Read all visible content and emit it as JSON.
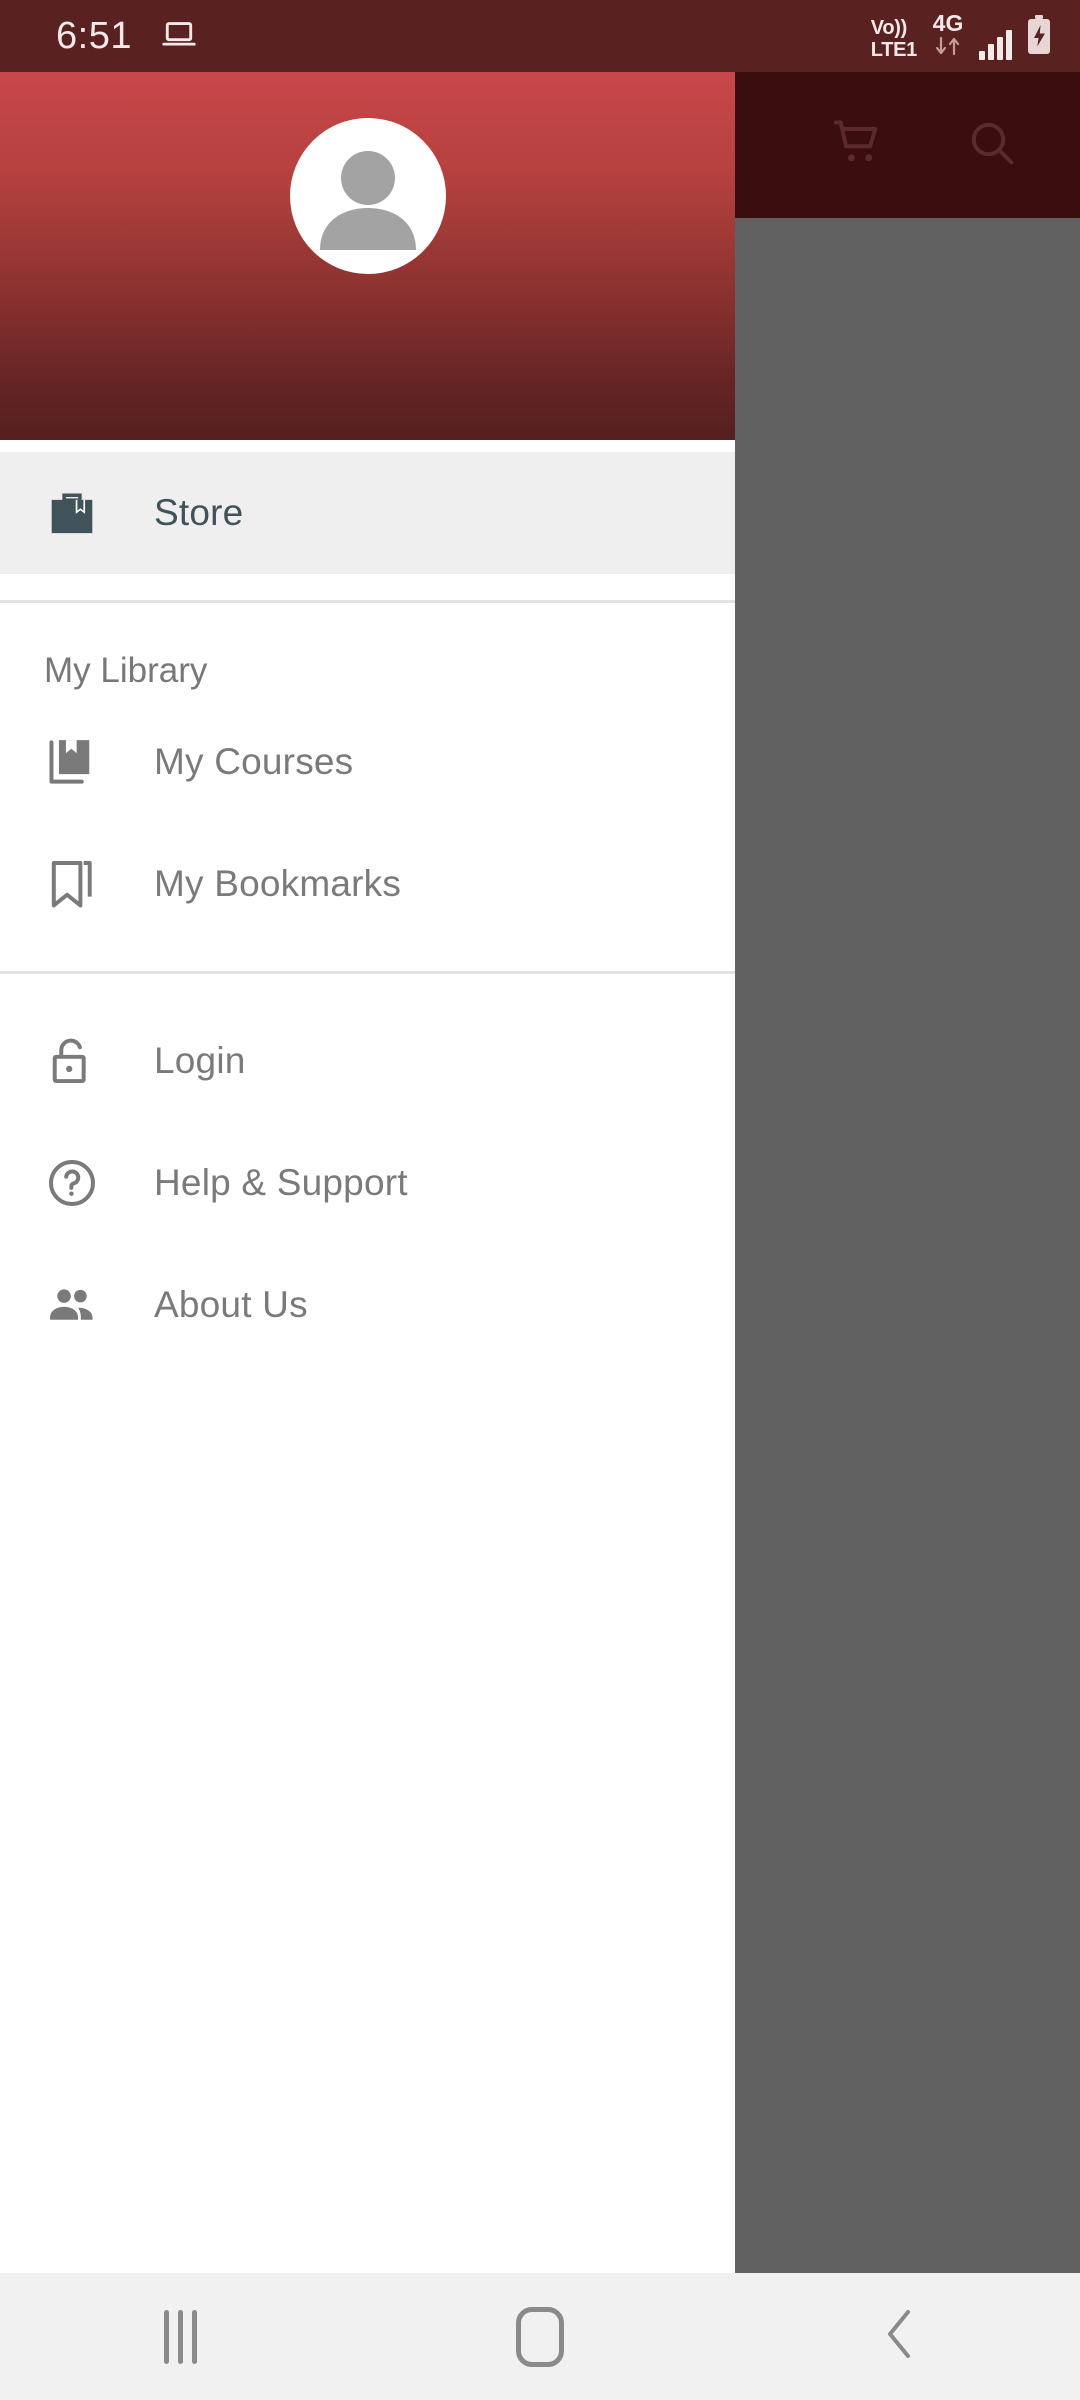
{
  "status_bar": {
    "time": "6:51",
    "cast_icon": "laptop-icon",
    "volte_line1": "Vo))",
    "volte_line2": "LTE1",
    "network_type": "4G",
    "data_arrows_icon": "data-transfer-icon",
    "signal_icon": "signal-bars-icon",
    "battery_icon": "battery-charging-icon",
    "background_color": "#5A2121"
  },
  "app_toolbar": {
    "cart_icon": "shopping-cart-icon",
    "search_icon": "search-icon",
    "background_color": "#3A0E0E"
  },
  "scrim": {
    "color": "#616161"
  },
  "drawer": {
    "header": {
      "avatar_icon": "account-circle-placeholder-icon",
      "gradient_top": "#C9474A",
      "gradient_bottom": "#552020"
    },
    "primary_items": [
      {
        "label": "Store",
        "icon": "store-bag-icon",
        "selected": true
      }
    ],
    "library_section": {
      "title": "My Library",
      "items": [
        {
          "label": "My Courses",
          "icon": "book-library-icon",
          "selected": false
        },
        {
          "label": "My Bookmarks",
          "icon": "bookmarks-outline-icon",
          "selected": false
        }
      ]
    },
    "account_items": [
      {
        "label": "Login",
        "icon": "unlock-icon",
        "selected": false
      },
      {
        "label": "Help & Support",
        "icon": "help-circle-icon",
        "selected": false
      },
      {
        "label": "About Us",
        "icon": "people-group-icon",
        "selected": false
      }
    ],
    "selected_row_color": "#EFEFEF",
    "selected_text_color": "#40535B",
    "item_text_color": "#7A7A7A"
  },
  "navigation_bar": {
    "recents_label": "recent-apps",
    "home_label": "home",
    "back_label": "back",
    "background_color": "#F1F1F1"
  }
}
